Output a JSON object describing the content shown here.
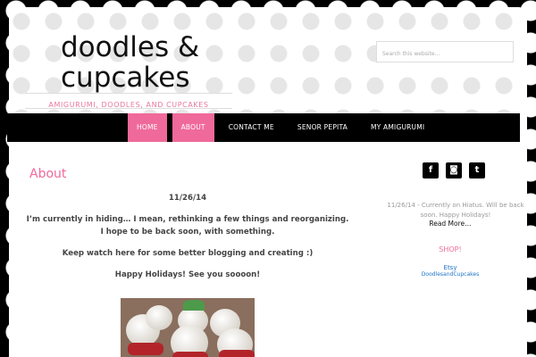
{
  "header": {
    "site_title_line1": "doodles &",
    "site_title_line2": "cupcakes",
    "tagline": "AMIGURUMI, DOODLES, AND CUPCAKES",
    "search_placeholder": "Search this website..."
  },
  "nav": {
    "items": [
      {
        "label": "HOME"
      },
      {
        "label": "ABOUT"
      },
      {
        "label": "CONTACT ME"
      },
      {
        "label": "SENOR PEPITA"
      },
      {
        "label": "MY AMIGURUMI"
      }
    ]
  },
  "main": {
    "title": "About",
    "date": "11/26/14",
    "para1_line1": "I’m currently in hiding… I mean, rethinking a few things and reorganizing.",
    "para1_line2": "I hope to be back soon, with something.",
    "para2": "Keep watch here for some better blogging and creating :)",
    "para3": "Happy Holidays! See you soooon!"
  },
  "sidebar": {
    "social": [
      {
        "icon": "facebook-icon",
        "glyph": "f"
      },
      {
        "icon": "instagram-icon",
        "glyph": "◙"
      },
      {
        "icon": "twitter-icon",
        "glyph": "t"
      }
    ],
    "promo_line1": "11/26/14 - Currently on Hiatus. Will be back",
    "promo_line2": "soon. Happy Holidays!",
    "read_more": "Read More…",
    "shop_title": "SHOP!",
    "shop_link1": "Etsy",
    "shop_link2": "DoodlesandCupcakes"
  },
  "colors": {
    "accent_pink": "#ef6a9a",
    "nav_black": "#000000",
    "link_blue": "#1a73c8"
  }
}
